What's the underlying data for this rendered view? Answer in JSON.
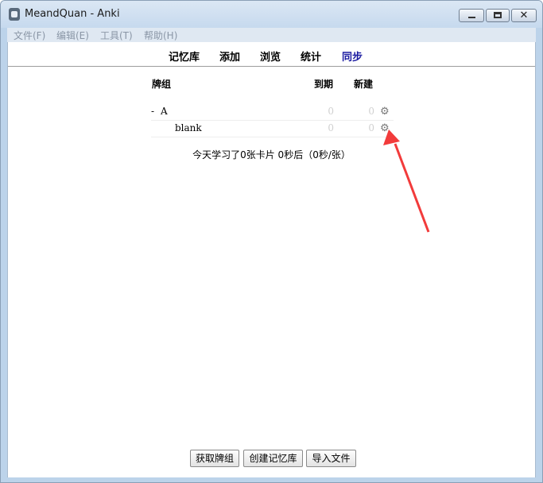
{
  "window": {
    "title": "MeandQuan - Anki",
    "close_glyph": "✕"
  },
  "menu": [
    {
      "label": "文件(F)"
    },
    {
      "label": "编辑(E)"
    },
    {
      "label": "工具(T)"
    },
    {
      "label": "帮助(H)"
    }
  ],
  "toolbar": {
    "decks": "记忆库",
    "add": "添加",
    "browse": "浏览",
    "stats": "统计",
    "sync": "同步"
  },
  "deck_table": {
    "headers": {
      "deck": "牌组",
      "due": "到期",
      "new": "新建"
    },
    "rows": [
      {
        "collapse": "-",
        "name": "A",
        "due": "0",
        "new": "0",
        "gear": "⚙"
      },
      {
        "collapse": "",
        "name": "blank",
        "due": "0",
        "new": "0",
        "gear": "⚙"
      }
    ]
  },
  "summary": "今天学习了0张卡片 0秒后（0秒/张）",
  "bottom_buttons": {
    "get_shared": "获取牌组",
    "create_deck": "创建记忆库",
    "import_file": "导入文件"
  },
  "annotation_color": "#f23b3b"
}
